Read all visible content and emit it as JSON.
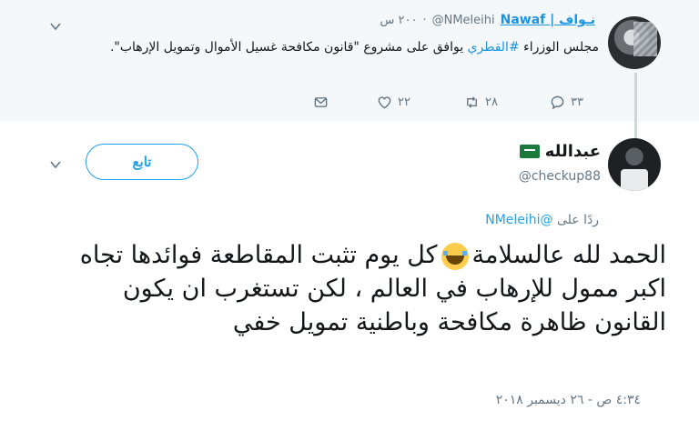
{
  "parent_tweet": {
    "author_name": "Nawaf | نـواف",
    "handle": "@NMeleihi",
    "time": "٢٠٠ س",
    "dot": "·",
    "text_before_hashtag": "مجلس الوزراء ",
    "hashtag": "#القطري",
    "text_after_hashtag": " يوافق على مشروع \"قانون مكافحة غسيل الأموال وتمويل الإرهاب\".",
    "actions": {
      "reply_count": "٣٣",
      "retweet_count": "٢٨",
      "like_count": "٢٢",
      "dm_icon": "envelope-icon"
    }
  },
  "main_tweet": {
    "author_name": "عبدالله",
    "flag": "saudi-flag-icon",
    "handle": "@checkup88",
    "follow_label": "تابع",
    "reply_to_prefix": "ردًا على ",
    "reply_to_handle": "@NMeleihi",
    "text_part1": "الحمد لله عالسلامة",
    "text_part2": "كل يوم تثبت المقاطعة فوائدها تجاه اكبر ممول للإرهاب في العالم ، لكن تستغرب ان يكون القانون ظاهرة مكافحة وباطنية تمويل خفي",
    "timestamp": "٤:٣٤ ص - ٢٦ ديسمبر ٢٠١٨"
  },
  "colors": {
    "accent": "#1da1f2",
    "link": "#1c94e0",
    "muted": "#657786",
    "parent_bg": "#f5f8fa"
  }
}
